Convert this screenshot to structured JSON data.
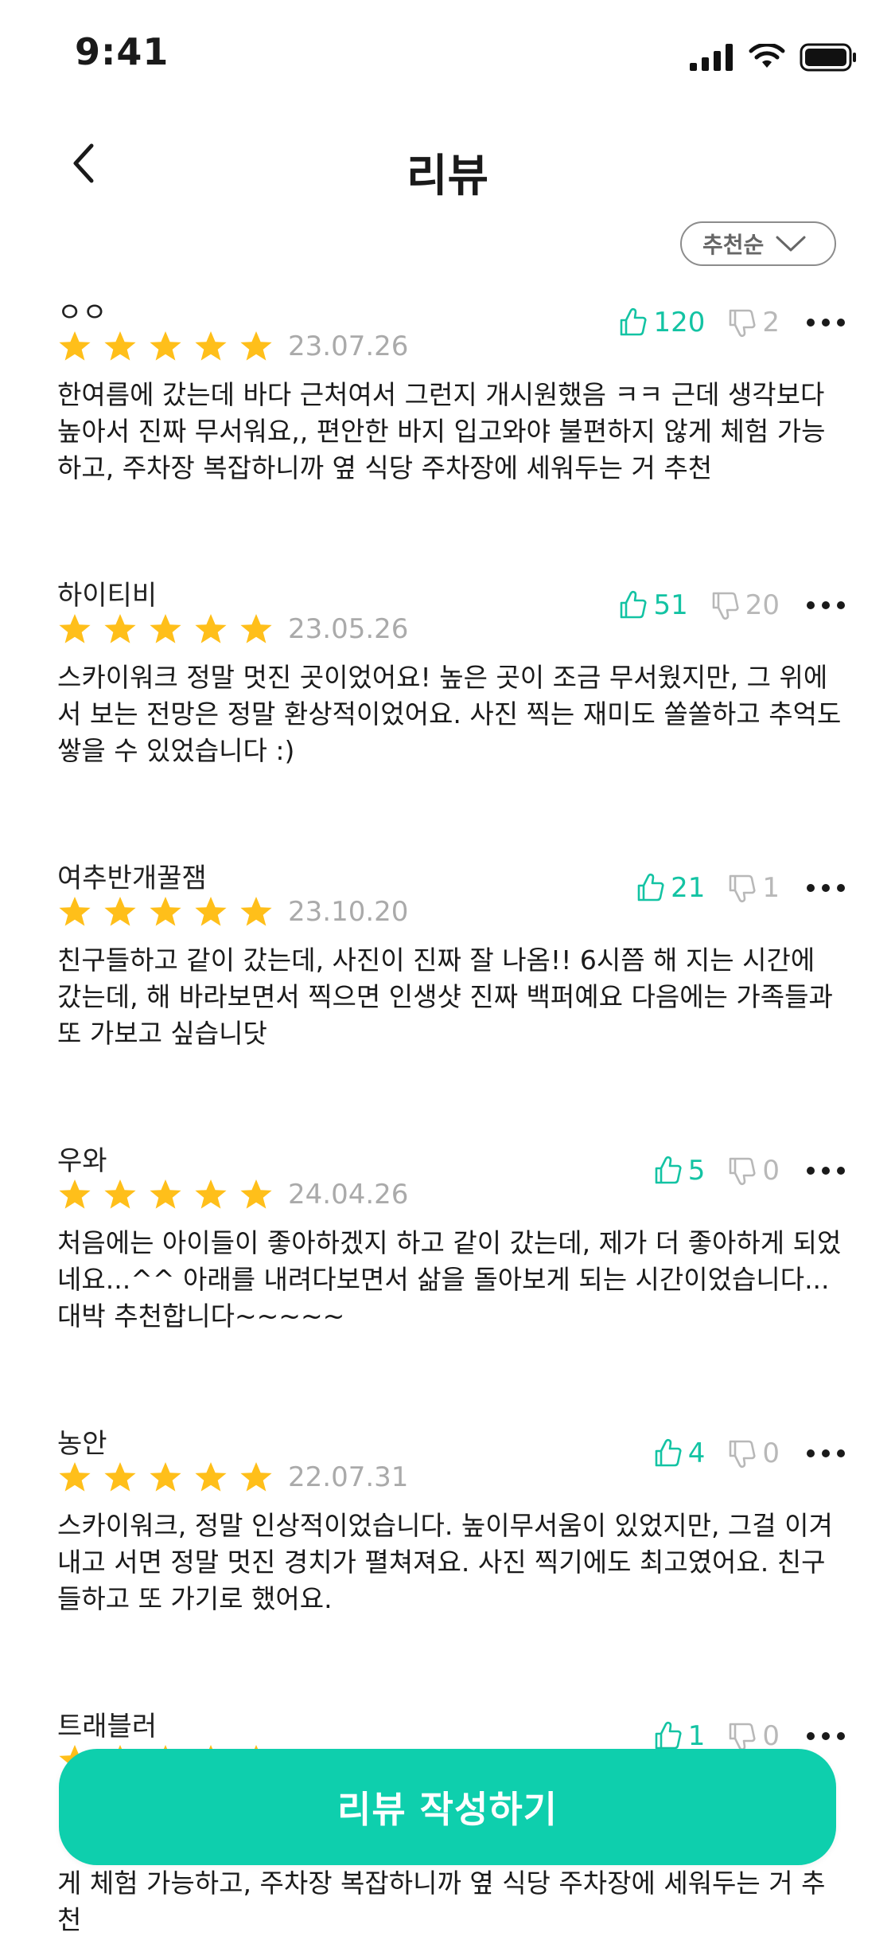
{
  "status_bar": {
    "time": "9:41",
    "icons": [
      "cellular-signal-icon",
      "wifi-icon",
      "battery-icon"
    ]
  },
  "header": {
    "title": "리뷰"
  },
  "sort": {
    "label": "추천순"
  },
  "colors": {
    "accent": "#0ecfad",
    "like": "#13c3a3",
    "star": "#ffbf1a",
    "muted": "#b8b8b8"
  },
  "reviews": [
    {
      "reviewer": "ㅇㅇ",
      "rating": 5,
      "date": "23.07.26",
      "likes": "120",
      "dislikes": "2",
      "text": "한여름에 갔는데 바다 근처여서 그런지 개시원했음 ㅋㅋ 근데 생각보다 높아서 진짜 무서워요,, 편안한 바지 입고와야 불편하지 않게 체험 가능하고, 주차장 복잡하니까 옆 식당 주차장에 세워두는 거 추천"
    },
    {
      "reviewer": "하이티비",
      "rating": 5,
      "date": "23.05.26",
      "likes": "51",
      "dislikes": "20",
      "text": "스카이워크 정말 멋진 곳이었어요! 높은 곳이 조금 무서웠지만, 그 위에서 보는 전망은 정말 환상적이었어요. 사진 찍는 재미도 쏠쏠하고 추억도 쌓을 수 있었습니다 :)"
    },
    {
      "reviewer": "여추반개꿀잼",
      "rating": 5,
      "date": "23.10.20",
      "likes": "21",
      "dislikes": "1",
      "text": "친구들하고 같이 갔는데, 사진이 진짜 잘 나옴!! 6시쯤 해 지는 시간에 갔는데, 해 바라보면서 찍으면 인생샷 진짜 백퍼예요 다음에는 가족들과 또 가보고 싶습니닷"
    },
    {
      "reviewer": "우와",
      "rating": 5,
      "date": "24.04.26",
      "likes": "5",
      "dislikes": "0",
      "text": "처음에는 아이들이 좋아하겠지 하고 같이 갔는데, 제가 더 좋아하게 되었네요...^^ 아래를 내려다보면서 삶을 돌아보게 되는 시간이었습니다... 대박 추천합니다~~~~~"
    },
    {
      "reviewer": "농안",
      "rating": 5,
      "date": "22.07.31",
      "likes": "4",
      "dislikes": "0",
      "text": "스카이워크, 정말 인상적이었습니다. 높이무서움이 있었지만, 그걸 이겨내고 서면 정말 멋진 경치가 펼쳐져요. 사진 찍기에도 최고였어요. 친구들하고 또 가기로 했어요."
    },
    {
      "reviewer": "트래블러",
      "rating": 5,
      "date": "",
      "likes": "1",
      "dislikes": "0",
      "text": ""
    }
  ],
  "partial_text_below_button": "게 체험 가능하고, 주차장 복잡하니까 옆 식당 주차장에 세워두는 거 추천",
  "cta": {
    "label": "리뷰 작성하기"
  }
}
